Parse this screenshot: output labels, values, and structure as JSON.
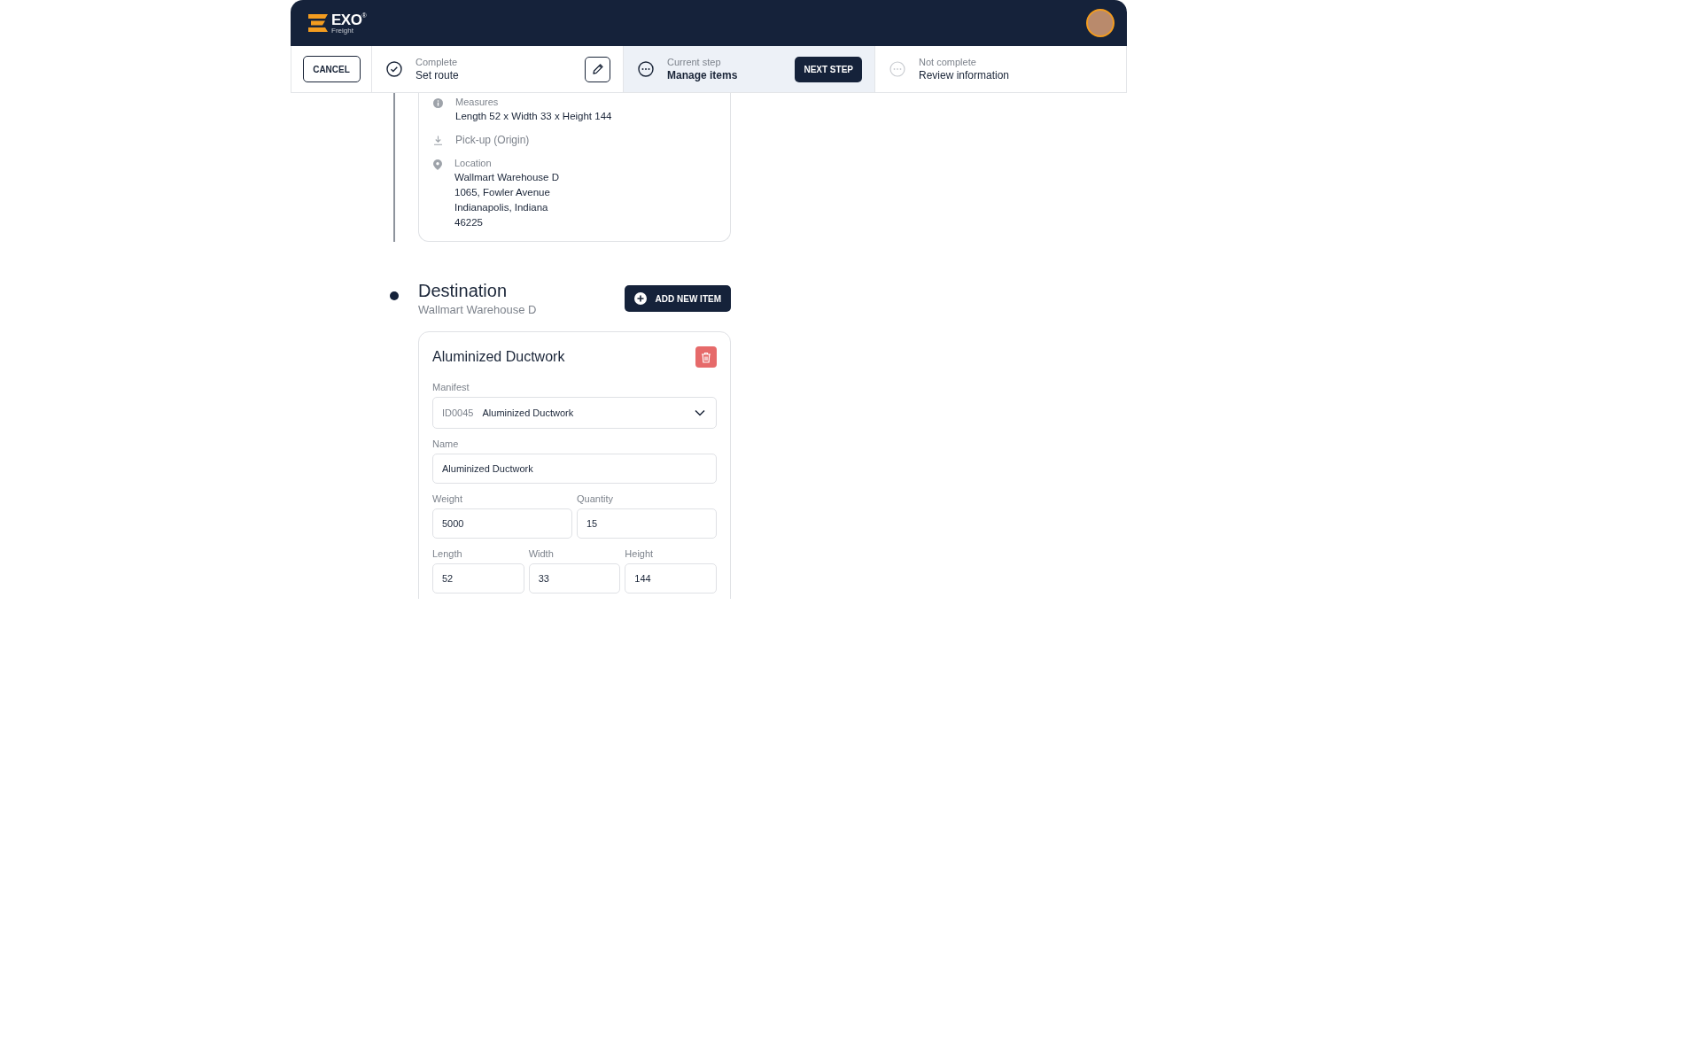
{
  "header": {
    "logo": {
      "wordmark": "EXO",
      "mark": "®",
      "sub": "Freight"
    }
  },
  "stepper": {
    "cancel": "CANCEL",
    "steps": [
      {
        "status": "Complete",
        "title": "Set route",
        "kind": "complete",
        "selected": false
      },
      {
        "status": "Current step",
        "title": "Manage items",
        "kind": "current",
        "selected": true,
        "action": "NEXT STEP"
      },
      {
        "status": "Not complete",
        "title": "Review information",
        "kind": "pending",
        "selected": false
      }
    ]
  },
  "origin_card": {
    "details": [
      {
        "kind": "info",
        "label": "Measures",
        "lines": [
          "Length 52 x Width 33 x Height 144"
        ]
      },
      {
        "kind": "pickup",
        "label": "Pick-up (Origin)"
      },
      {
        "kind": "location",
        "label": "Location",
        "lines": [
          "Wallmart Warehouse D",
          "1065, Fowler Avenue",
          "Indianapolis, Indiana",
          "46225"
        ]
      }
    ]
  },
  "destination": {
    "title": "Destination",
    "subtitle": "Wallmart Warehouse D",
    "add_button": "ADD NEW ITEM",
    "item": {
      "title": "Aluminized Ductwork",
      "manifest": {
        "label": "Manifest",
        "id": "ID0045",
        "value": "Aluminized Ductwork"
      },
      "field_rows": [
        [
          {
            "label": "Name",
            "value": "Aluminized Ductwork"
          }
        ],
        [
          {
            "label": "Weight",
            "value": "5000"
          },
          {
            "label": "Quantity",
            "value": "15"
          }
        ],
        [
          {
            "label": "Length",
            "value": "52"
          },
          {
            "label": "Width",
            "value": "33"
          },
          {
            "label": "Height",
            "value": "144"
          }
        ]
      ]
    }
  }
}
